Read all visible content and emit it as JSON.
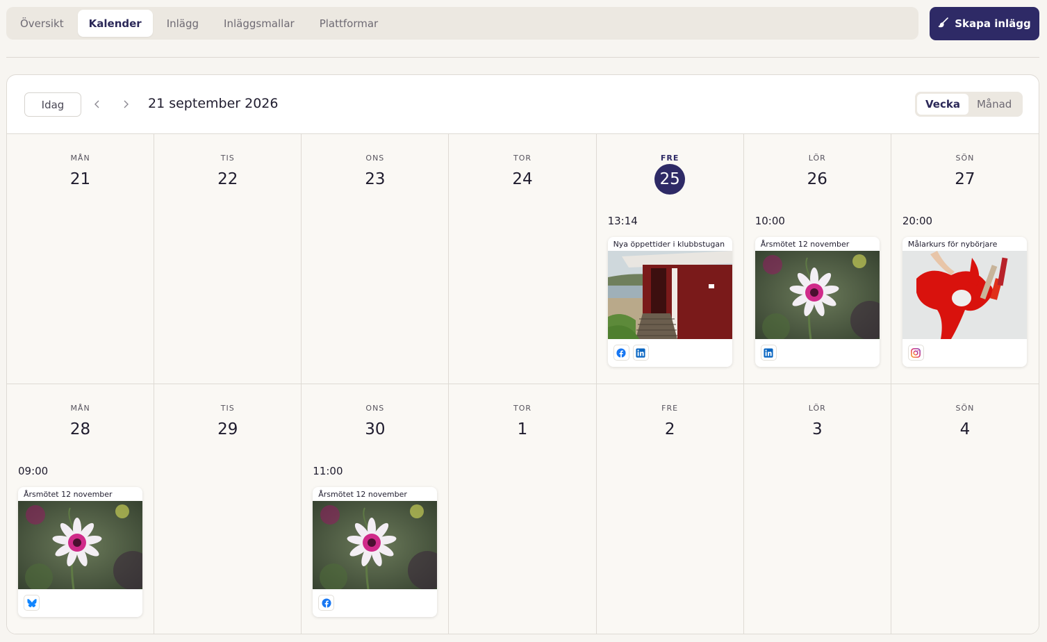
{
  "tabs": [
    "Översikt",
    "Kalender",
    "Inlägg",
    "Inläggsmallar",
    "Plattformar"
  ],
  "active_tab": 1,
  "create_button": "Skapa inlägg",
  "toolbar": {
    "today": "Idag",
    "date_title": "21 september 2026",
    "views": [
      "Vecka",
      "Månad"
    ]
  },
  "weeks": [
    [
      {
        "weekday": "MÅN",
        "day": "21"
      },
      {
        "weekday": "TIS",
        "day": "22"
      },
      {
        "weekday": "ONS",
        "day": "23"
      },
      {
        "weekday": "TOR",
        "day": "24"
      },
      {
        "weekday": "FRE",
        "day": "25",
        "today": true,
        "post": {
          "time": "13:14",
          "title": "Nya öppettider i klubbstugan",
          "image": "cabin",
          "platforms": [
            "facebook",
            "linkedin"
          ]
        }
      },
      {
        "weekday": "LÖR",
        "day": "26",
        "post": {
          "time": "10:00",
          "title": "Årsmötet 12 november",
          "image": "flower",
          "platforms": [
            "linkedin"
          ]
        }
      },
      {
        "weekday": "SÖN",
        "day": "27",
        "post": {
          "time": "20:00",
          "title": "Målarkurs för nybörjare",
          "image": "paint",
          "platforms": [
            "instagram"
          ]
        }
      }
    ],
    [
      {
        "weekday": "MÅN",
        "day": "28",
        "post": {
          "time": "09:00",
          "title": "Årsmötet 12 november",
          "image": "flower",
          "platforms": [
            "bluesky"
          ]
        }
      },
      {
        "weekday": "TIS",
        "day": "29"
      },
      {
        "weekday": "ONS",
        "day": "30",
        "post": {
          "time": "11:00",
          "title": "Årsmötet 12 november",
          "image": "flower",
          "platforms": [
            "facebook"
          ]
        }
      },
      {
        "weekday": "TOR",
        "day": "1"
      },
      {
        "weekday": "FRE",
        "day": "2"
      },
      {
        "weekday": "LÖR",
        "day": "3"
      },
      {
        "weekday": "SÖN",
        "day": "4"
      }
    ]
  ],
  "colors": {
    "accent": "#2e2a66",
    "facebook": "#1877f2",
    "linkedin": "#0a66c2",
    "bluesky": "#1185fe",
    "instagram": "#e1306c"
  }
}
